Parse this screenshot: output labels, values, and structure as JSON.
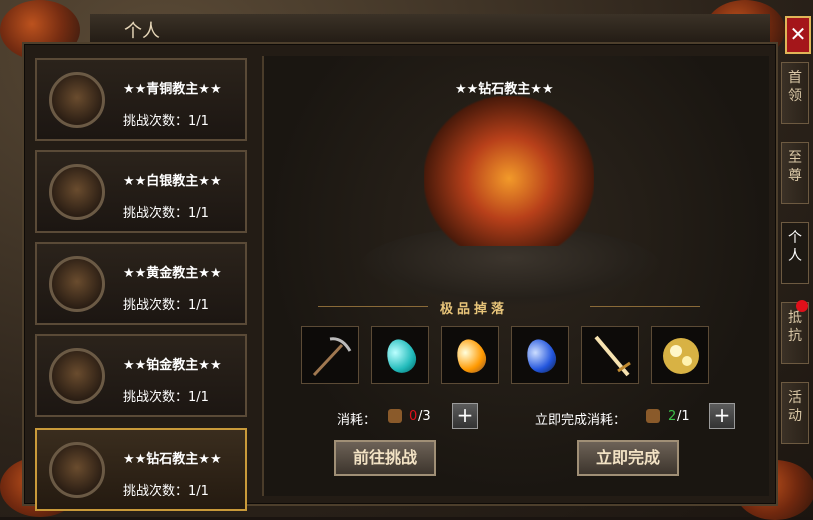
{
  "window": {
    "title": "个人",
    "close_label": "✕"
  },
  "tabs": [
    {
      "label": "首领"
    },
    {
      "label": "至尊"
    },
    {
      "label": "个人"
    },
    {
      "label": "抵抗"
    },
    {
      "label": "活动"
    }
  ],
  "bosses": [
    {
      "name": "★★青铜教主★★",
      "count": "挑战次数：1/1"
    },
    {
      "name": "★★白银教主★★",
      "count": "挑战次数：1/1"
    },
    {
      "name": "★★黄金教主★★",
      "count": "挑战次数：1/1"
    },
    {
      "name": "★★铂金教主★★",
      "count": "挑战次数：1/1"
    },
    {
      "name": "★★钻石教主★★",
      "count": "挑战次数：1/1"
    }
  ],
  "selected": {
    "title": "★★钻石教主★★",
    "drops_header": "极品掉落",
    "drops": [
      "pickaxe-icon",
      "cyan-gem-icon",
      "orange-gem-icon",
      "blue-gem-icon",
      "sword-icon",
      "gold-fragments-icon"
    ],
    "cost_label": "消耗：",
    "cost_have": "0",
    "cost_need": "/3",
    "complete_cost_label": "立即完成消耗：",
    "complete_have": "2",
    "complete_need": "/1",
    "challenge_button": "前往挑战",
    "complete_button": "立即完成"
  },
  "colors": {
    "accent_gold": "#c99a3a",
    "red": "#e0101a",
    "green": "#3cc04a"
  }
}
